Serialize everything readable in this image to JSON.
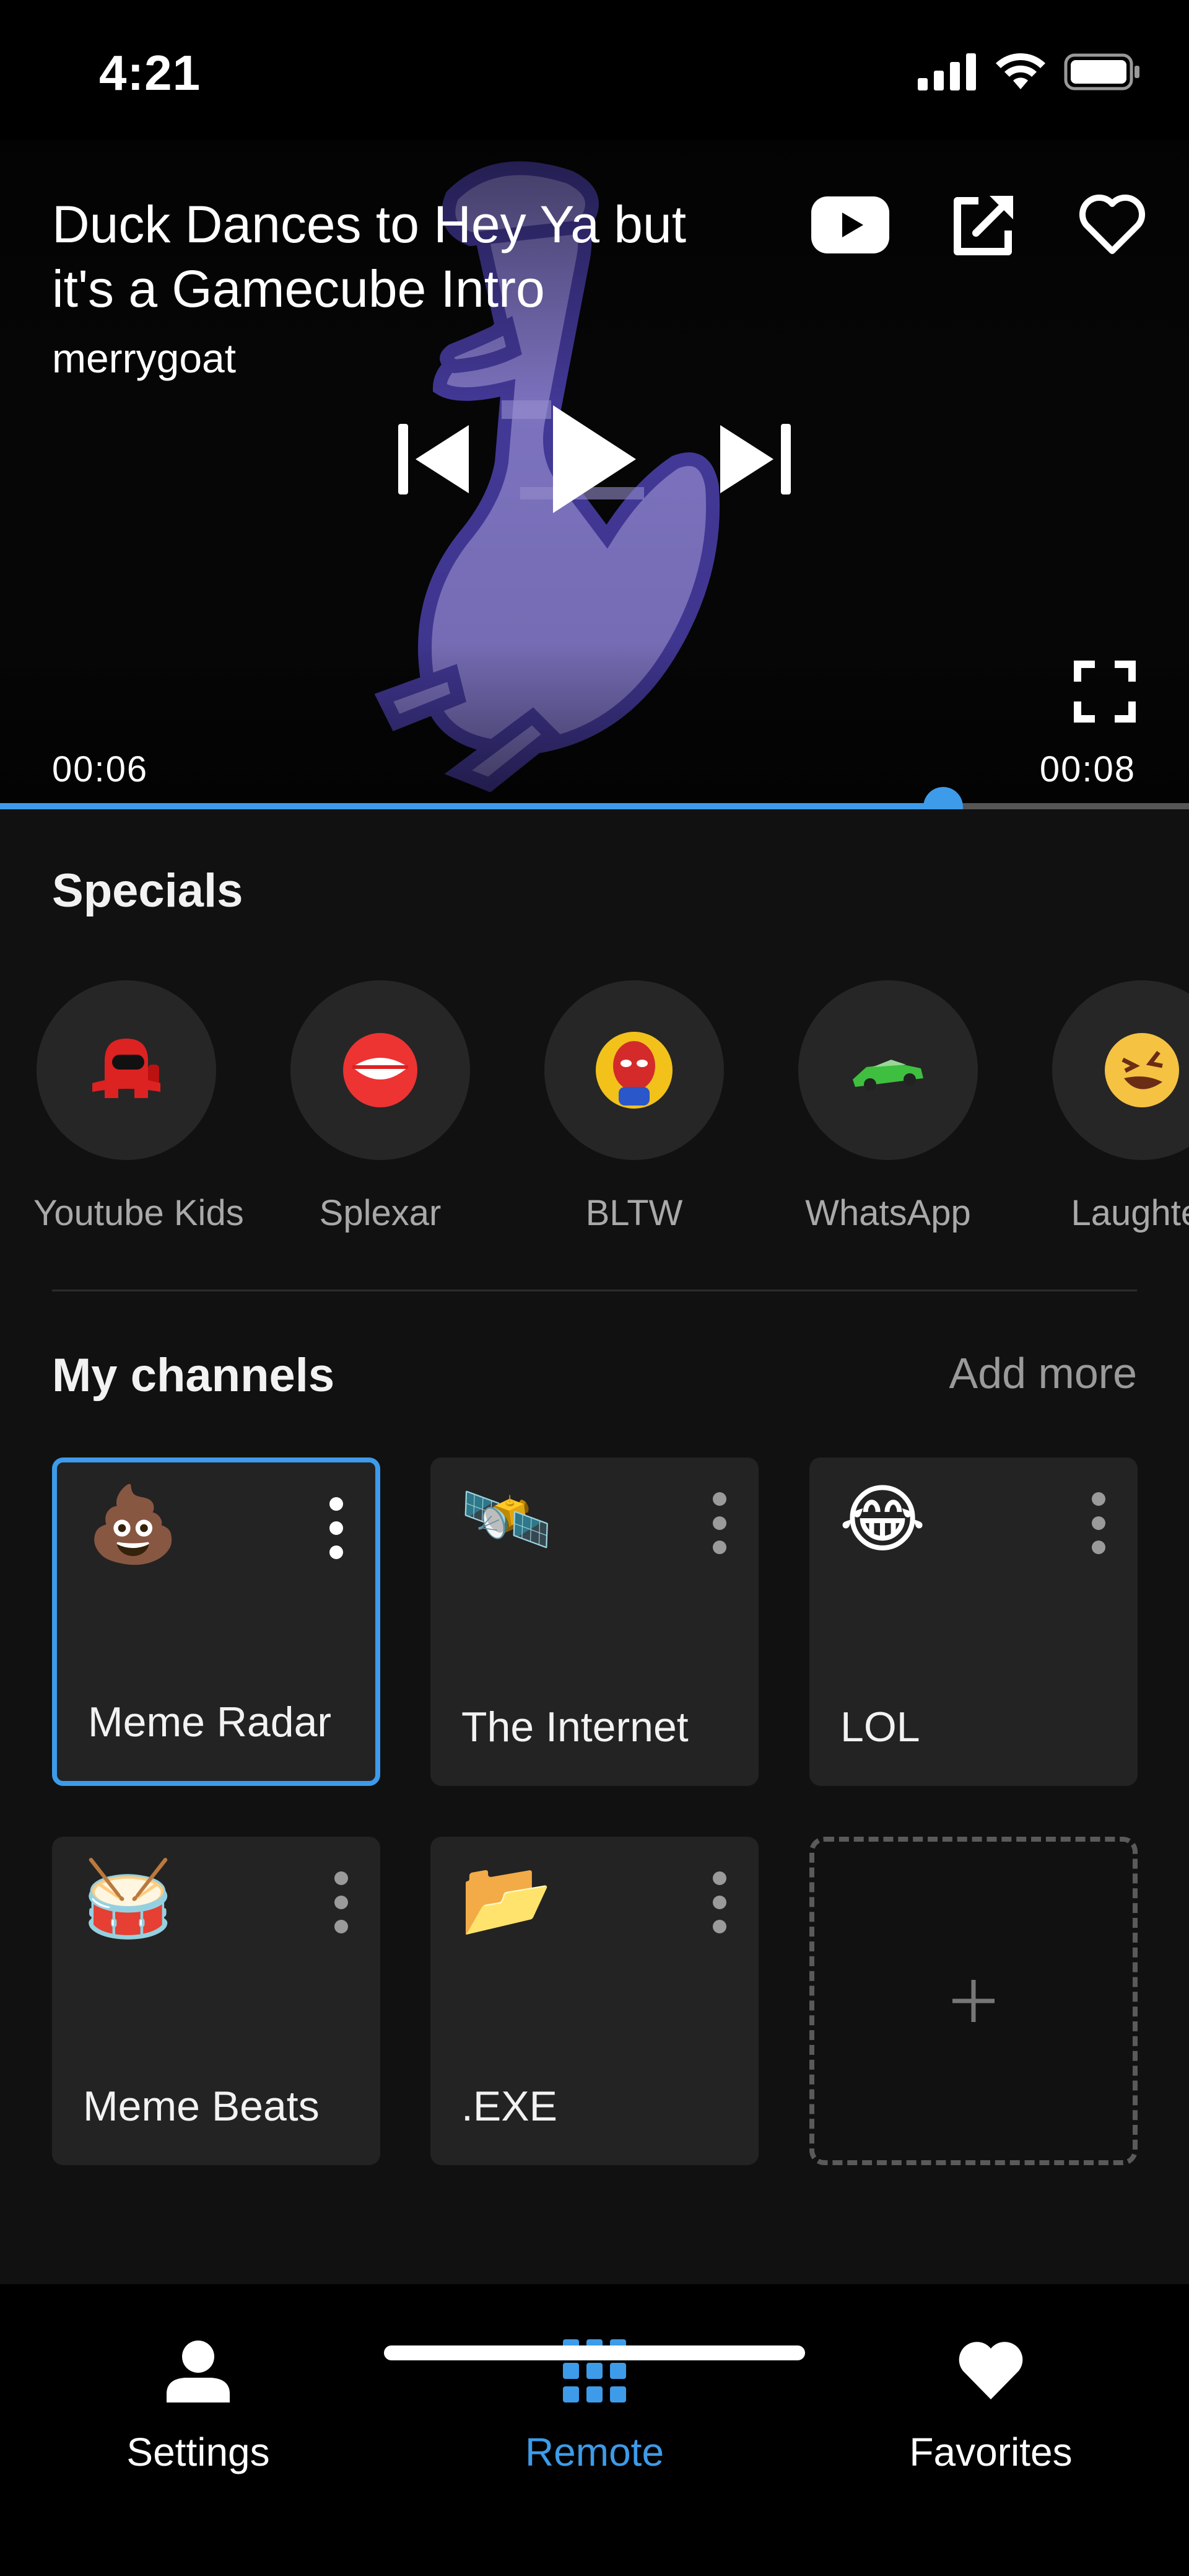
{
  "status_bar": {
    "time": "4:21"
  },
  "player": {
    "title": "Duck Dances to Hey Ya but it's a Gamecube Intro",
    "channel": "merrygoat",
    "current_time": "00:06",
    "duration": "00:08",
    "progress": 0.793,
    "icons": {
      "youtube": "youtube-icon",
      "share": "share-external-icon",
      "favorite": "heart-icon",
      "previous": "skip-previous-icon",
      "play": "play-icon",
      "next": "skip-next-icon",
      "fullscreen": "fullscreen-icon"
    }
  },
  "specials": {
    "title": "Specials",
    "items": [
      {
        "label": "Youtube Kids",
        "icon": "red-crewmate-icon"
      },
      {
        "label": "Splexar",
        "icon": "lips-icon"
      },
      {
        "label": "BLTW",
        "icon": "spider-man-icon"
      },
      {
        "label": "WhatsApp",
        "icon": "race-car-icon"
      },
      {
        "label": "Laughter",
        "icon": "rolling-laughing-emoji"
      }
    ]
  },
  "channels": {
    "title": "My channels",
    "add_more": "Add more",
    "items": [
      {
        "label": "Meme Radar",
        "emoji": "💩",
        "selected": true
      },
      {
        "label": "The Internet",
        "emoji": "🛰️",
        "selected": false
      },
      {
        "label": "LOL",
        "emoji": "😂",
        "selected": false
      },
      {
        "label": "Meme Beats",
        "emoji": "🥁",
        "selected": false
      },
      {
        "label": ".EXE",
        "emoji": "📂",
        "selected": false
      }
    ],
    "add_tile_icon": "plus-icon"
  },
  "nav": {
    "items": [
      {
        "label": "Settings",
        "icon": "person-icon",
        "active": false
      },
      {
        "label": "Remote",
        "icon": "grid-icon",
        "active": true
      },
      {
        "label": "Favorites",
        "icon": "heart-icon",
        "active": false
      }
    ]
  },
  "colors": {
    "accent": "#3d9be9",
    "background": "#111111",
    "tile": "#232323",
    "duck": "#8a7fd4"
  }
}
